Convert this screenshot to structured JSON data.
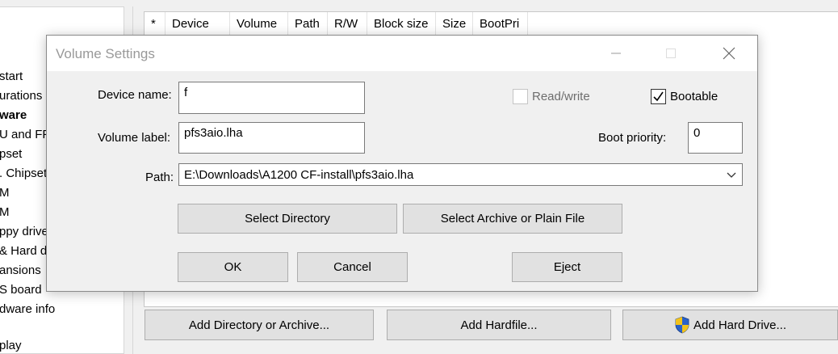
{
  "tree": {
    "items": [
      {
        "label": "start",
        "bold": false
      },
      {
        "label": "urations",
        "bold": false
      },
      {
        "label": "ware",
        "bold": true
      },
      {
        "label": "U and FPU",
        "bold": false
      },
      {
        "label": "pset",
        "bold": false
      },
      {
        "label": ". Chipset",
        "bold": false
      },
      {
        "label": "M",
        "bold": false
      },
      {
        "label": "M",
        "bold": false
      },
      {
        "label": "ppy drive",
        "bold": false
      },
      {
        "label": "& Hard d",
        "bold": false
      },
      {
        "label": "ansions",
        "bold": false
      },
      {
        "label": "S board",
        "bold": false
      },
      {
        "label": "dware info",
        "bold": false
      },
      {
        "label": "play",
        "bold": false
      }
    ]
  },
  "list": {
    "columns": [
      "*",
      "Device",
      "Volume",
      "Path",
      "R/W",
      "Block size",
      "Size",
      "BootPri"
    ]
  },
  "bottom_buttons": {
    "add_directory": "Add Directory or Archive...",
    "add_hardfile": "Add Hardfile...",
    "add_hard_drive": "Add Hard Drive..."
  },
  "dialog": {
    "title": "Volume Settings",
    "device_name_label": "Device name:",
    "device_name_value": "f",
    "volume_label_label": "Volume label:",
    "volume_label_value": "pfs3aio.lha",
    "path_label": "Path:",
    "path_value": "E:\\Downloads\\A1200 CF-install\\pfs3aio.lha",
    "readwrite_label": "Read/write",
    "readwrite_checked": false,
    "bootable_label": "Bootable",
    "bootable_checked": true,
    "boot_priority_label": "Boot priority:",
    "boot_priority_value": "0",
    "select_directory": "Select Directory",
    "select_archive": "Select Archive or Plain File",
    "ok": "OK",
    "cancel": "Cancel",
    "eject": "Eject"
  },
  "icons": {
    "minimize": "minimize-icon",
    "maximize": "maximize-icon",
    "close": "close-icon",
    "shield": "uac-shield-icon",
    "dropdown": "chevron-down-icon",
    "check": "checkmark-icon"
  },
  "colors": {
    "window_bg": "#f0f0f0",
    "button_bg": "#e1e1e1",
    "shield_blue": "#2a62c9",
    "shield_yellow": "#f2c21b",
    "disabled_text": "#6d6d6d"
  }
}
